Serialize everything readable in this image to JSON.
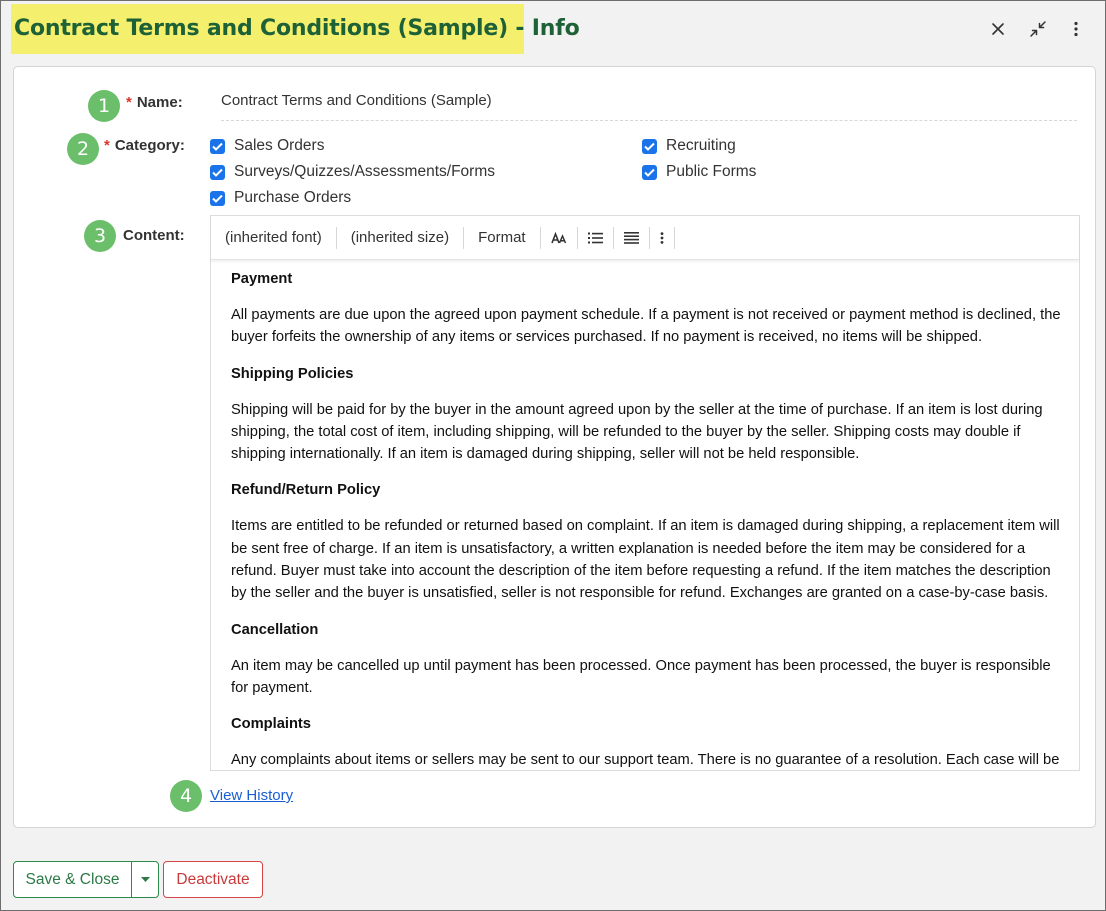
{
  "window": {
    "title": "Contract Terms and Conditions (Sample) - Info",
    "close_icon": "close-icon",
    "collapse_icon": "collapse-icon",
    "more_icon": "more-vertical-icon"
  },
  "steps": [
    "1",
    "2",
    "3",
    "4"
  ],
  "form": {
    "required_mark": "*",
    "name_label": "Name:",
    "name_value": "Contract Terms and Conditions (Sample)",
    "category_label": "Category:",
    "categories": [
      {
        "label": "Sales Orders",
        "checked": true
      },
      {
        "label": "Surveys/Quizzes/Assessments/Forms",
        "checked": true
      },
      {
        "label": "Purchase Orders",
        "checked": true
      },
      {
        "label": "Recruiting",
        "checked": true
      },
      {
        "label": "Public Forms",
        "checked": true
      }
    ],
    "content_label": "Content:"
  },
  "editor": {
    "toolbar": {
      "font": "(inherited font)",
      "size": "(inherited size)",
      "format": "Format"
    },
    "sections": [
      {
        "heading": "Payment",
        "body": "All payments are due upon the agreed upon payment schedule. If a payment is not received or payment method is declined, the buyer forfeits the ownership of any items or services purchased. If no payment is received, no items will be shipped."
      },
      {
        "heading": "Shipping Policies",
        "body": "Shipping will be paid for by the buyer in the amount agreed upon by the seller at the time of purchase. If an item is lost during shipping, the total cost of item, including shipping, will be refunded to the buyer by the seller. Shipping costs may double if shipping internationally. If an item is damaged during shipping, seller will not be held responsible."
      },
      {
        "heading": "Refund/Return Policy",
        "body": "Items are entitled to be refunded or returned based on complaint. If an item is damaged during shipping, a replacement item will be sent free of charge. If an item is unsatisfactory, a written explanation is needed before the item may be considered for a refund. Buyer must take into account the description of the item before requesting a refund. If the item matches the description by the seller and the buyer is unsatisfied, seller is not responsible for refund. Exchanges are granted on a case-by-case basis."
      },
      {
        "heading": "Cancellation",
        "body": "An item may be cancelled up until payment has been processed. Once payment has been processed, the buyer is responsible for payment."
      },
      {
        "heading": "Complaints",
        "body": "Any complaints about items or sellers may be sent to our support team. There is no guarantee of a resolution. Each case will be"
      }
    ]
  },
  "view_history": "View History",
  "footer": {
    "save_close": "Save & Close",
    "deactivate": "Deactivate"
  },
  "colors": {
    "title_highlight": "#f5ef6e",
    "title_text": "#1d6137",
    "step_badge": "#6bbf6b",
    "checkbox": "#1a73e8",
    "save_button": "#2c8a4a",
    "deactivate_button": "#d64545",
    "link": "#1a5fd1"
  }
}
